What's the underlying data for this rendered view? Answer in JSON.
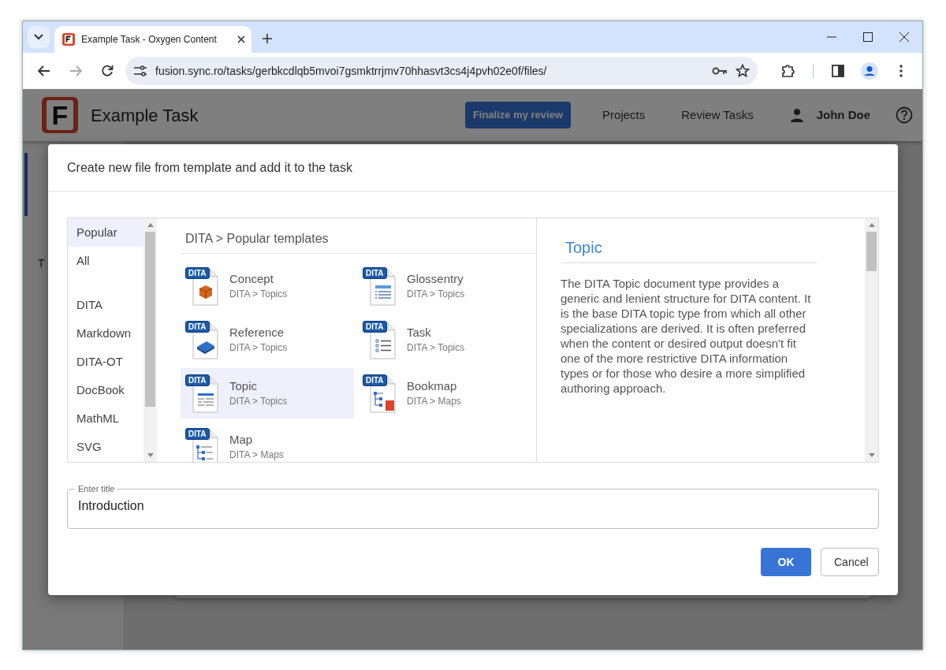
{
  "browser": {
    "tabs": [
      {
        "title": "Example Task - Oxygen Content",
        "selected": true
      }
    ],
    "url": "fusion.sync.ro/tasks/gerbkcdlqb5mvoi7gsmktrrjmv70hhasvt3cs4j4pvh02e0f/files/",
    "forward_disabled": true
  },
  "app": {
    "logo_letter": "F",
    "title": "Example Task",
    "finalize_button": "Finalize my review",
    "nav": [
      "Projects",
      "Review Tasks"
    ],
    "user": "John Doe",
    "background_text": "T"
  },
  "dialog": {
    "title": "Create new file from template and add it to the task",
    "quick_filters": [
      {
        "label": "Popular",
        "selected": true
      },
      {
        "label": "All",
        "selected": false
      }
    ],
    "categories": [
      {
        "label": "DITA",
        "selected": false
      },
      {
        "label": "Markdown",
        "selected": false
      },
      {
        "label": "DITA-OT",
        "selected": false
      },
      {
        "label": "DocBook",
        "selected": false
      },
      {
        "label": "MathML",
        "selected": false
      },
      {
        "label": "SVG",
        "selected": false
      }
    ],
    "breadcrumb": "DITA > Popular templates",
    "templates": [
      {
        "name": "Concept",
        "path": "DITA > Topics",
        "badge": "DITA",
        "kind": "concept",
        "selected": false
      },
      {
        "name": "Glossentry",
        "path": "DITA > Topics",
        "badge": "DITA",
        "kind": "glossentry",
        "selected": false
      },
      {
        "name": "Reference",
        "path": "DITA > Topics",
        "badge": "DITA",
        "kind": "reference",
        "selected": false
      },
      {
        "name": "Task",
        "path": "DITA > Topics",
        "badge": "DITA",
        "kind": "task",
        "selected": false
      },
      {
        "name": "Topic",
        "path": "DITA > Topics",
        "badge": "DITA",
        "kind": "topic",
        "selected": true
      },
      {
        "name": "Bookmap",
        "path": "DITA > Maps",
        "badge": "DITA",
        "kind": "bookmap",
        "selected": false
      },
      {
        "name": "Map",
        "path": "DITA > Maps",
        "badge": "DITA",
        "kind": "map",
        "selected": false
      }
    ],
    "details": {
      "title": "Topic",
      "description": "The DITA Topic document type provides a generic and lenient structure for DITA content. It is the base DITA topic type from which all other specializations are derived. It is often preferred when the content or desired output doesn't fit one of the more restrictive DITA information types or for those who desire a more simplified authoring approach."
    },
    "title_field": {
      "label": "Enter title",
      "value": "Introduction"
    },
    "buttons": [
      {
        "label": "OK",
        "kind": "primary"
      },
      {
        "label": "Cancel",
        "kind": "secondary"
      }
    ]
  }
}
